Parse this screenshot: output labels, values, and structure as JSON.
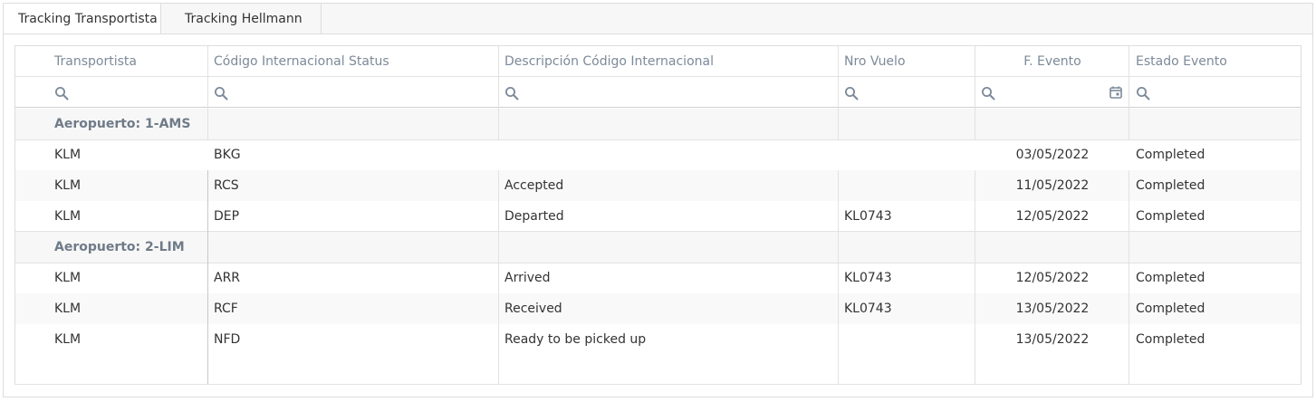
{
  "tabs": [
    {
      "label": "Tracking Transportista",
      "active": true
    },
    {
      "label": "Tracking Hellmann",
      "active": false
    }
  ],
  "columns": [
    "Transportista",
    "Código Internacional Status",
    "Descripción Código Internacional",
    "Nro Vuelo",
    "F. Evento",
    "Estado Evento"
  ],
  "icons": {
    "filter": "search-icon",
    "date": "calendar-icon"
  },
  "groups": [
    {
      "label": "Aeropuerto: 1-AMS",
      "rows": [
        [
          "KLM",
          "BKG",
          "",
          "",
          "03/05/2022",
          "Completed"
        ],
        [
          "KLM",
          "RCS",
          "Accepted",
          "",
          "11/05/2022",
          "Completed"
        ],
        [
          "KLM",
          "DEP",
          "Departed",
          "KL0743",
          "12/05/2022",
          "Completed"
        ]
      ]
    },
    {
      "label": "Aeropuerto: 2-LIM",
      "rows": [
        [
          "KLM",
          "ARR",
          "Arrived",
          "KL0743",
          "12/05/2022",
          "Completed"
        ],
        [
          "KLM",
          "RCF",
          "Received",
          "KL0743",
          "13/05/2022",
          "Completed"
        ],
        [
          "KLM",
          "NFD",
          "Ready to be picked up",
          "",
          "13/05/2022",
          "Completed"
        ]
      ]
    }
  ],
  "colors": {
    "header_text": "#7c8a99",
    "group_text": "#6f7b88",
    "icon": "#7c8a99",
    "border": "#dddddd"
  }
}
